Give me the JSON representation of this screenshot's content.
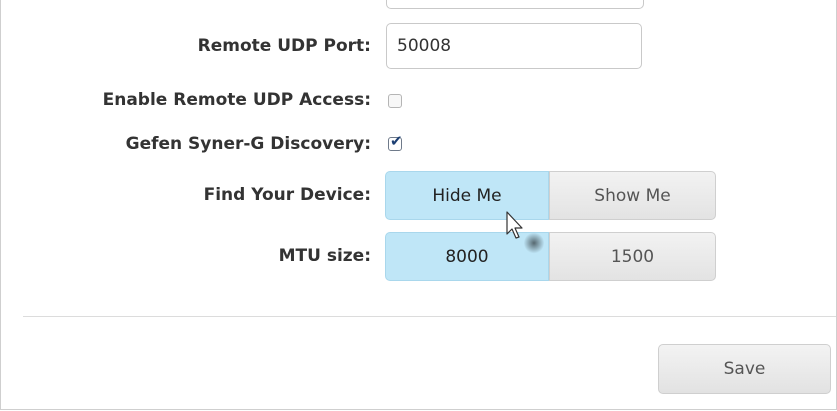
{
  "form": {
    "remote_udp_port": {
      "label": "Remote UDP Port:",
      "value": "50008"
    },
    "enable_remote_udp_access": {
      "label": "Enable Remote UDP Access:",
      "checked": false
    },
    "gefen_discovery": {
      "label": "Gefen Syner-G Discovery:",
      "checked": true
    },
    "find_device": {
      "label": "Find Your Device:",
      "options": [
        "Hide Me",
        "Show Me"
      ],
      "selected": "Hide Me"
    },
    "mtu_size": {
      "label": "MTU size:",
      "options": [
        "8000",
        "1500"
      ],
      "selected": "8000"
    }
  },
  "save_label": "Save",
  "colors": {
    "active_segment": "#bfe6f7",
    "inactive_segment": "#e8e8e8"
  },
  "icons": {
    "checkmark": "checkmark-icon",
    "cursor": "mouse-cursor-icon"
  }
}
